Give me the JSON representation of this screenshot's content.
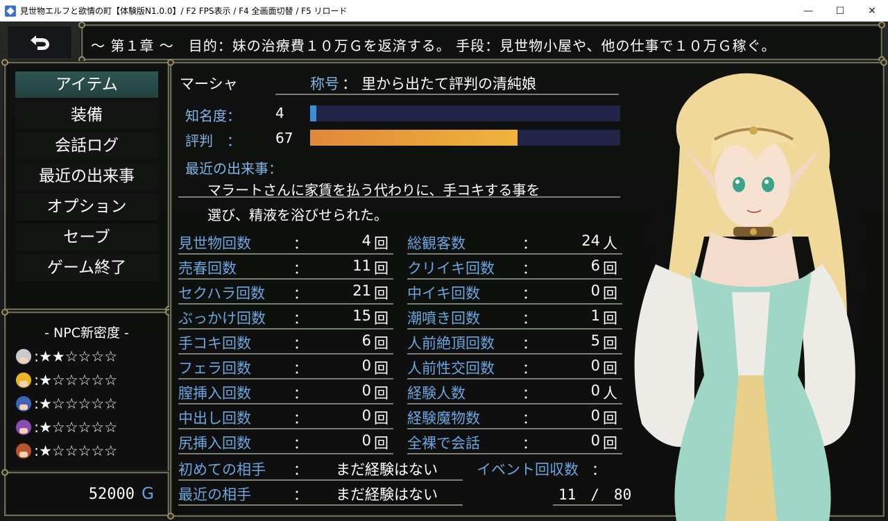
{
  "window": {
    "title": "見世物エルフと欲情の町【体験版N1.0.0】/ F2 FPS表示 / F4 全画面切替 / F5 リロード",
    "minimize": "—",
    "maximize": "☐",
    "close": "✕"
  },
  "banner": {
    "text": "～ 第１章 ～　目的：妹の治療費１０万Ｇを返済する。 手段：見世物小屋や、他の仕事で１０万Ｇ稼ぐ。"
  },
  "menu": {
    "items": [
      "アイテム",
      "装備",
      "会話ログ",
      "最近の出来事",
      "オプション",
      "セーブ",
      "ゲーム終了"
    ],
    "active_index": 0
  },
  "npc": {
    "title": "- NPC新密度 -",
    "rows": [
      {
        "icon": "silver-hair-npc-icon",
        "stars": ":★★☆☆☆☆",
        "hair": "#c9c9cf"
      },
      {
        "icon": "blonde-npc-icon",
        "stars": ":★☆☆☆☆☆",
        "hair": "#e9b528"
      },
      {
        "icon": "blue-hair-npc-icon",
        "stars": ":★☆☆☆☆☆",
        "hair": "#3e63b8"
      },
      {
        "icon": "purple-hair-npc-icon",
        "stars": ":★☆☆☆☆☆",
        "hair": "#8a4bb5"
      },
      {
        "icon": "red-hair-npc-icon",
        "stars": ":★☆☆☆☆☆",
        "hair": "#b5542d"
      }
    ]
  },
  "gold": {
    "amount": "52000",
    "unit": "G"
  },
  "status": {
    "name": "マーシャ",
    "title_label": "称号",
    "title_colon": "：",
    "title_value": "里から出たて評判の清純娘",
    "fame_label": "知名度：",
    "fame_value": "4",
    "fame_ratio": 0.02,
    "reputation_label": "評判　：",
    "reputation_value": "67",
    "reputation_ratio": 0.67,
    "recent_label": "最近の出来事：",
    "recent_line1": "マラートさんに家賃を払う代わりに、手コキする事を",
    "recent_line2": "選び、精液を浴びせられた。",
    "colon": "：",
    "left_stats": [
      {
        "label": "見世物回数",
        "value": "4",
        "unit": "回"
      },
      {
        "label": "売春回数",
        "value": "11",
        "unit": "回"
      },
      {
        "label": "セクハラ回数",
        "value": "21",
        "unit": "回"
      },
      {
        "label": "ぶっかけ回数",
        "value": "15",
        "unit": "回"
      },
      {
        "label": "手コキ回数",
        "value": "6",
        "unit": "回"
      },
      {
        "label": "フェラ回数",
        "value": "0",
        "unit": "回"
      },
      {
        "label": "膣挿入回数",
        "value": "0",
        "unit": "回"
      },
      {
        "label": "中出し回数",
        "value": "0",
        "unit": "回"
      },
      {
        "label": "尻挿入回数",
        "value": "0",
        "unit": "回"
      }
    ],
    "right_stats": [
      {
        "label": "総観客数",
        "value": "24",
        "unit": "人"
      },
      {
        "label": "クリイキ回数",
        "value": "6",
        "unit": "回"
      },
      {
        "label": "中イキ回数",
        "value": "0",
        "unit": "回"
      },
      {
        "label": "潮噴き回数",
        "value": "1",
        "unit": "回"
      },
      {
        "label": "人前絶頂回数",
        "value": "5",
        "unit": "回"
      },
      {
        "label": "人前性交回数",
        "value": "0",
        "unit": "回"
      },
      {
        "label": "経験人数",
        "value": "0",
        "unit": "人"
      },
      {
        "label": "経験魔物数",
        "value": "0",
        "unit": "回"
      },
      {
        "label": "全裸で会話",
        "value": "0",
        "unit": "回"
      }
    ],
    "first_partner_label": "初めての相手",
    "first_partner_value": "まだ経験はない",
    "recent_partner_label": "最近の相手",
    "recent_partner_value": "まだ経験はない",
    "event_label": "イベント回収数",
    "event_colon": "：",
    "event_value": "11　/　80"
  },
  "colors": {
    "label_blue": "#6aa6e0",
    "fame_bar": "#3d8fd6",
    "reputation_bar_start": "#e0883a",
    "reputation_bar_end": "#f0b43c",
    "bar_track": "#222447",
    "menu_active": "#2f5553"
  }
}
